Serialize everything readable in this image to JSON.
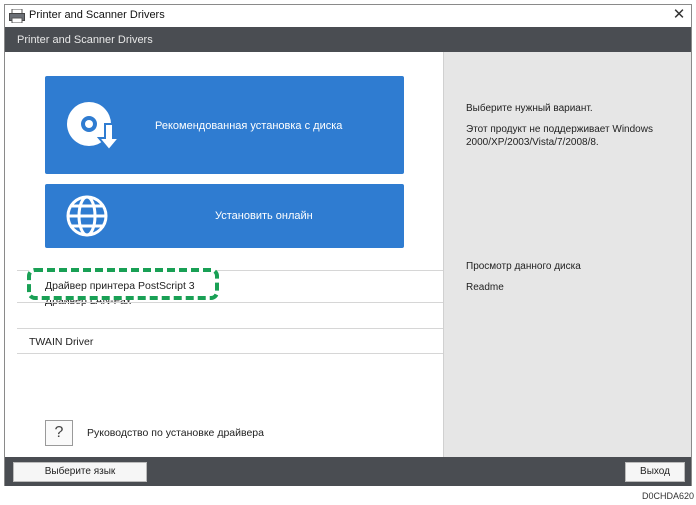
{
  "window": {
    "title": "Printer and Scanner Drivers",
    "close_glyph": "✕"
  },
  "header": {
    "text": "Printer and Scanner Drivers"
  },
  "main": {
    "disc_button": {
      "label": "Рекомендованная установка с диска",
      "icon": "disc-install-icon"
    },
    "online_button": {
      "label": "Установить онлайн",
      "icon": "globe-icon"
    },
    "list": [
      {
        "label": "Драйвер принтера PostScript 3"
      },
      {
        "label": "Драйвер LAN-Fax"
      },
      {
        "label": "TWAIN Driver"
      }
    ],
    "guide": {
      "glyph": "?",
      "label": "Руководство по установке драйвера"
    }
  },
  "sidebar": {
    "prompt": "Выберите нужный вариант.",
    "note": "Этот продукт не поддерживает Windows 2000/XP/2003/Vista/7/2008/8.",
    "links": [
      {
        "label": "Просмотр данного диска"
      },
      {
        "label": "Readme"
      }
    ]
  },
  "footer": {
    "language_button": "Выберите язык",
    "exit_button": "Выход"
  },
  "image_code": "D0CHDA620",
  "colors": {
    "accent_blue": "#2f7cd1",
    "header_bar": "#4a4d52",
    "highlight_green": "#19a055",
    "side_panel": "#e6e6e6"
  }
}
